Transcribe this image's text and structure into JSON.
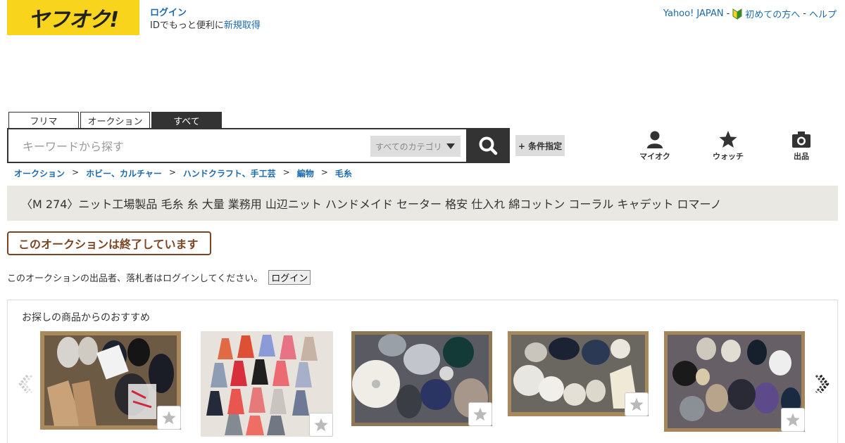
{
  "header": {
    "logo_text": "ヤフオク!",
    "login_label": "ログイン",
    "login_sub": "IDでもっと便利に",
    "signup_label": "新規取得",
    "links": [
      "Yahoo! JAPAN",
      "初めての方へ",
      "ヘルプ"
    ],
    "link_sep": "-"
  },
  "tabs": [
    "フリマ",
    "オークション",
    "すべて"
  ],
  "search": {
    "placeholder": "キーワードから探す",
    "category": "すべてのカテゴリ",
    "condition_label": "+ 条件指定"
  },
  "nav": {
    "my": "マイオク",
    "watch": "ウォッチ",
    "sell": "出品"
  },
  "breadcrumb": [
    "オークション",
    "ホビー、カルチャー",
    "ハンドクラフト、手工芸",
    "編物",
    "毛糸"
  ],
  "breadcrumb_sep": ">",
  "item_title": "〈M 274〉ニット工場製品 毛糸 糸 大量 業務用 山辺ニット ハンドメイド セーター 格安 仕入れ 綿コットン コーラル キャデット ロマーノ",
  "ended_notice": "このオークションは終了しています",
  "login_prompt": "このオークションの出品者、落札者はログインしてください。",
  "login_button": "ログイン",
  "recommend": {
    "title": "お探しの商品からのおすすめ"
  },
  "colors": {
    "logo_bg": "#f8d51c",
    "link": "#1a6aad",
    "dark": "#333333",
    "title_bg": "#e9e8e2",
    "ended": "#7a4522"
  }
}
